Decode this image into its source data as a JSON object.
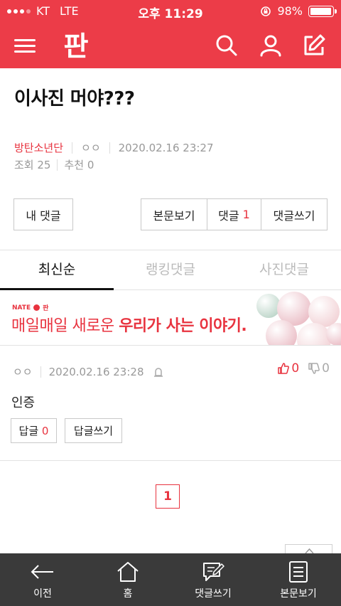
{
  "status_bar": {
    "carrier": "KT",
    "network": "LTE",
    "time": "오후 11:29",
    "battery": "98%",
    "battery_level": 0.98
  },
  "header": {
    "logo_text": "판"
  },
  "post": {
    "title": "이사진 머야???",
    "board": "방탄소년단",
    "author": "ㅇㅇ",
    "datetime": "2020.02.16 23:27",
    "views": "조회 25",
    "recommend": "추천 0"
  },
  "actions": {
    "my_comment": "내 댓글",
    "view_post": "본문보기",
    "comments_label": "댓글",
    "comments_count": "1",
    "write_comment": "댓글쓰기"
  },
  "tabs": [
    {
      "label": "최신순",
      "active": true
    },
    {
      "label": "랭킹댓글",
      "active": false
    },
    {
      "label": "사진댓글",
      "active": false
    }
  ],
  "banner": {
    "brand": "NATE",
    "brand_sub": "판",
    "slogan_plain": "매일매일 새로운",
    "slogan_bold": "우리가 사는 이야기."
  },
  "comment": {
    "author": "ㅇㅇ",
    "datetime": "2020.02.16 23:28",
    "up": "0",
    "down": "0",
    "body": "인증",
    "reply_label": "답글",
    "reply_count": "0",
    "write_reply": "답글쓰기"
  },
  "pagination": {
    "current": "1"
  },
  "bottom_nav": [
    {
      "label": "이전",
      "icon": "back-arrow-icon"
    },
    {
      "label": "홈",
      "icon": "home-icon"
    },
    {
      "label": "댓글쓰기",
      "icon": "write-comment-icon"
    },
    {
      "label": "본문보기",
      "icon": "document-icon"
    }
  ],
  "colors": {
    "brand_red": "#ec3c48",
    "accent_red": "#e8333f",
    "nav_dark": "#3a3a3a"
  }
}
